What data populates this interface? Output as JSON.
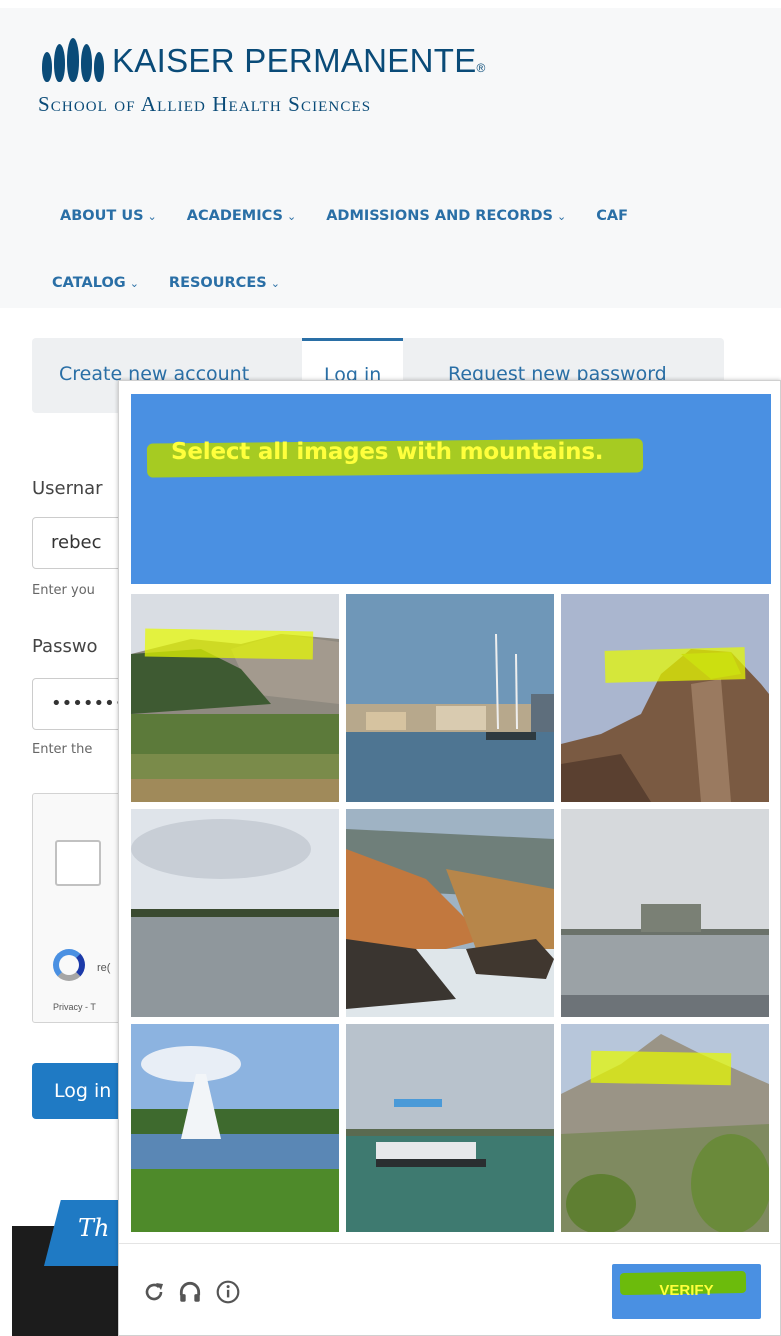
{
  "brand": {
    "name": "KAISER PERMANENTE",
    "registered": "®",
    "subtitle": "School of Allied Health Sciences"
  },
  "nav": {
    "row1": [
      "ABOUT US",
      "ACADEMICS",
      "ADMISSIONS AND RECORDS",
      "CAF"
    ],
    "row2": [
      "CATALOG",
      "RESOURCES"
    ]
  },
  "tabs": [
    "Create new account",
    "Log in",
    "Request new password"
  ],
  "form": {
    "username_label": "Usernar",
    "username_value": "rebec",
    "username_help": "Enter you",
    "password_label": "Passwo",
    "password_value": "••••••••",
    "password_help": "Enter the",
    "recaptcha_name": "re(",
    "recaptcha_links": "Privacy - T",
    "login_button": "Log in"
  },
  "banner_text": "Th",
  "challenge": {
    "prefix": "Select all images with ",
    "keyword": "mountains.",
    "tiles": [
      {
        "name": "tile-valley-mountain",
        "highlighted": true
      },
      {
        "name": "tile-harbor",
        "highlighted": false
      },
      {
        "name": "tile-cliff",
        "highlighted": true
      },
      {
        "name": "tile-lake",
        "highlighted": false
      },
      {
        "name": "tile-autumn-forest",
        "highlighted": false
      },
      {
        "name": "tile-bay",
        "highlighted": false
      },
      {
        "name": "tile-fountain",
        "highlighted": false
      },
      {
        "name": "tile-boat",
        "highlighted": false
      },
      {
        "name": "tile-hill",
        "highlighted": true
      }
    ],
    "verify_label": "VERIFY"
  },
  "colors": {
    "header_blue": "#4a90e2",
    "highlight_yellow": "#ffff3c",
    "nav_blue": "#2a6fa6",
    "brand_navy": "#0a4b78"
  }
}
